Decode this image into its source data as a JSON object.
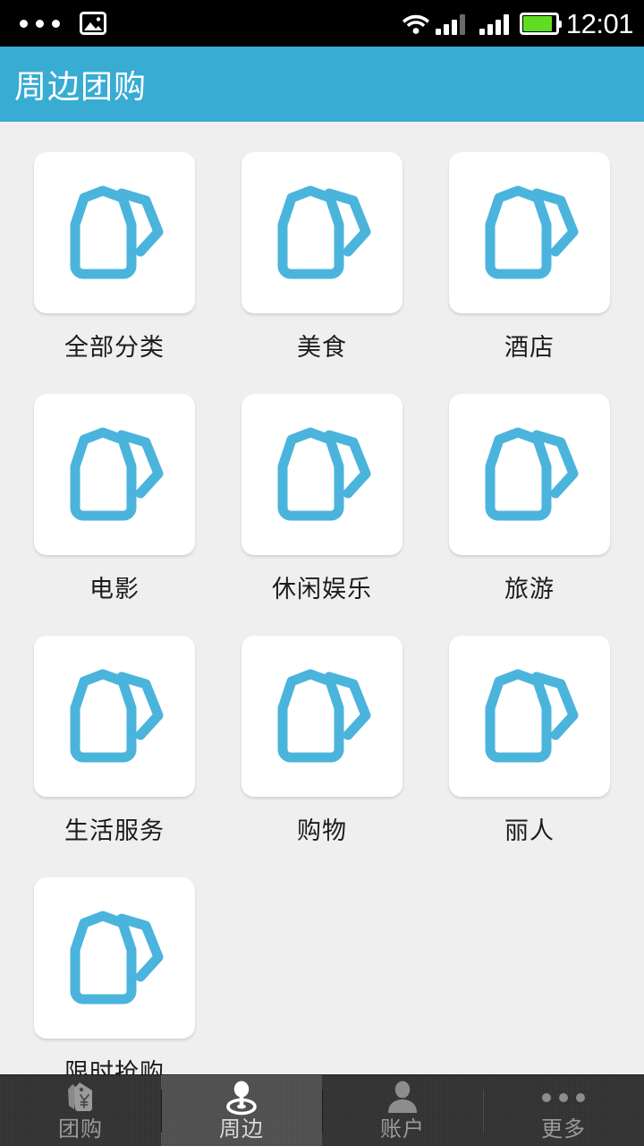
{
  "status_bar": {
    "time": "12:01",
    "left_icons": [
      "more-dots-icon",
      "image-icon"
    ],
    "right_icons": [
      "wifi-icon",
      "signal-sim1-icon",
      "signal-sim2-icon",
      "battery-icon"
    ],
    "battery_level_percent": 85,
    "background_color": "#000000"
  },
  "header": {
    "title": "周边团购",
    "background_color": "#38acd3",
    "text_color": "#ffffff"
  },
  "theme": {
    "page_background": "#efefef",
    "card_background": "#ffffff",
    "icon_blue": "#4bb4dc",
    "label_color": "#1c1c1c",
    "tabbar_background": "#2e2e2e",
    "tabbar_active_background": "#4a4a4a"
  },
  "grid": {
    "columns": 3,
    "icon_name": "price-tag-icon",
    "items": [
      {
        "label": "全部分类",
        "icon": "price-tag-icon"
      },
      {
        "label": "美食",
        "icon": "price-tag-icon"
      },
      {
        "label": "酒店",
        "icon": "price-tag-icon"
      },
      {
        "label": "电影",
        "icon": "price-tag-icon"
      },
      {
        "label": "休闲娱乐",
        "icon": "price-tag-icon"
      },
      {
        "label": "旅游",
        "icon": "price-tag-icon"
      },
      {
        "label": "生活服务",
        "icon": "price-tag-icon"
      },
      {
        "label": "购物",
        "icon": "price-tag-icon"
      },
      {
        "label": "丽人",
        "icon": "price-tag-icon"
      },
      {
        "label": "限时抢购",
        "icon": "price-tag-icon"
      }
    ]
  },
  "tabbar": {
    "active_index": 1,
    "tabs": [
      {
        "label": "团购",
        "icon": "price-tag-yen-icon"
      },
      {
        "label": "周边",
        "icon": "location-pin-icon"
      },
      {
        "label": "账户",
        "icon": "person-icon"
      },
      {
        "label": "更多",
        "icon": "more-dots-icon"
      }
    ]
  }
}
